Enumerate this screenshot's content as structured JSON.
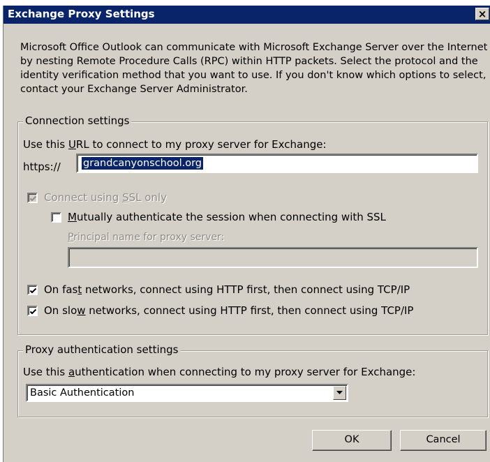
{
  "dialog": {
    "title": "Exchange Proxy Settings",
    "close_label": "×",
    "intro": "Microsoft Office Outlook can communicate with Microsoft Exchange Server over the Internet by nesting Remote Procedure Calls (RPC) within HTTP packets.  Select the protocol and the identity verification method that you want to use.  If you don't know which options to select, contact your Exchange Server Administrator."
  },
  "connection": {
    "legend": "Connection settings",
    "url_label_pre": "Use this ",
    "url_label_key": "U",
    "url_label_post": "RL to connect to my proxy server for Exchange:",
    "url_prefix": "https://",
    "url_value": "grandcanyonschool.org",
    "ssl_only": {
      "pre": "Connect using ",
      "key": "S",
      "post": "SL only",
      "checked": true,
      "enabled": false
    },
    "mutual_auth": {
      "pre": "",
      "key": "M",
      "post": "utually authenticate the session when connecting with SSL",
      "checked": false
    },
    "principal_label": {
      "key": "P",
      "post": "rincipal name for proxy server:"
    },
    "principal_value": "",
    "fast_networks": {
      "pre": "On fas",
      "key": "t",
      "post": " networks, connect using HTTP first, then connect using TCP/IP",
      "checked": true
    },
    "slow_networks": {
      "pre": "On slo",
      "key": "w",
      "post": " networks, connect using HTTP first, then connect using TCP/IP",
      "checked": true
    }
  },
  "proxy_auth": {
    "legend": "Proxy authentication settings",
    "label_pre": "Use this ",
    "label_key": "a",
    "label_post": "uthentication when connecting to my proxy server for Exchange:",
    "selected": "Basic Authentication"
  },
  "buttons": {
    "ok": "OK",
    "cancel": "Cancel"
  }
}
